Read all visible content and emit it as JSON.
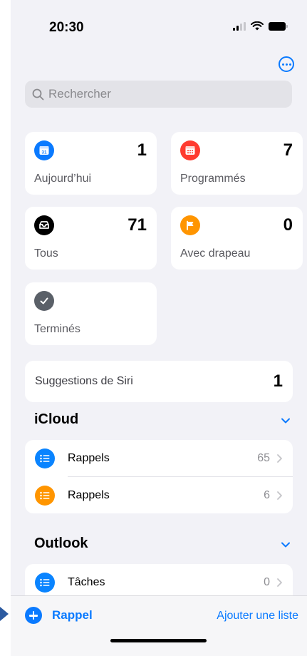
{
  "status_bar": {
    "time": "20:30"
  },
  "search": {
    "placeholder": "Rechercher"
  },
  "tiles": {
    "today": {
      "label": "Aujourd’hui",
      "count": "1",
      "color": "#0a7aff",
      "icon": "calendar-icon",
      "day": "31"
    },
    "scheduled": {
      "label": "Programmés",
      "count": "7",
      "color": "#ff3b30",
      "icon": "calendar-grid-icon"
    },
    "all": {
      "label": "Tous",
      "count": "71",
      "color": "#000000",
      "icon": "tray-icon"
    },
    "flagged": {
      "label": "Avec drapeau",
      "count": "0",
      "color": "#ff9500",
      "icon": "flag-icon"
    },
    "completed": {
      "label": "Terminés",
      "color": "#5a6068",
      "icon": "checkmark-icon"
    }
  },
  "siri": {
    "label": "Suggestions de Siri",
    "count": "1"
  },
  "sections": {
    "icloud": {
      "title": "iCloud",
      "lists": [
        {
          "name": "Rappels",
          "count": "65",
          "color": "#0a84ff",
          "icon": "list-icon"
        },
        {
          "name": "Rappels",
          "count": "6",
          "color": "#ff9500",
          "icon": "list-icon"
        }
      ]
    },
    "outlook": {
      "title": "Outlook",
      "lists": [
        {
          "name": "Tâches",
          "count": "0",
          "color": "#0a84ff",
          "icon": "list-icon"
        }
      ]
    }
  },
  "toolbar": {
    "add_reminder": "Rappel",
    "add_list": "Ajouter une liste"
  }
}
